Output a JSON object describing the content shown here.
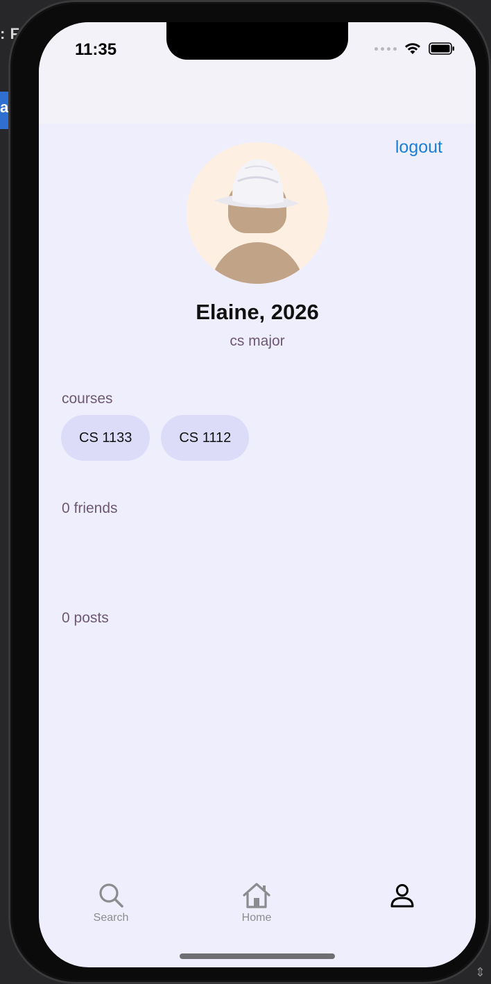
{
  "status_bar": {
    "time": "11:35"
  },
  "header": {
    "logout_label": "logout"
  },
  "profile": {
    "name_year": "Elaine, 2026",
    "major": "cs major"
  },
  "courses": {
    "label": "courses",
    "items": [
      "CS 1133",
      "CS 1112"
    ]
  },
  "friends": {
    "label": "0 friends"
  },
  "posts": {
    "label": "0 posts"
  },
  "tabbar": {
    "search_label": "Search",
    "home_label": "Home",
    "profile_icon": "person-icon"
  },
  "background_window": {
    "title_fragment": ": F",
    "tab_fragment": "ai"
  },
  "colors": {
    "accent_link": "#1a7fd6",
    "chip_bg": "#dcdcf8",
    "screen_bg": "#eeeefc",
    "muted_text": "#6e5874"
  }
}
